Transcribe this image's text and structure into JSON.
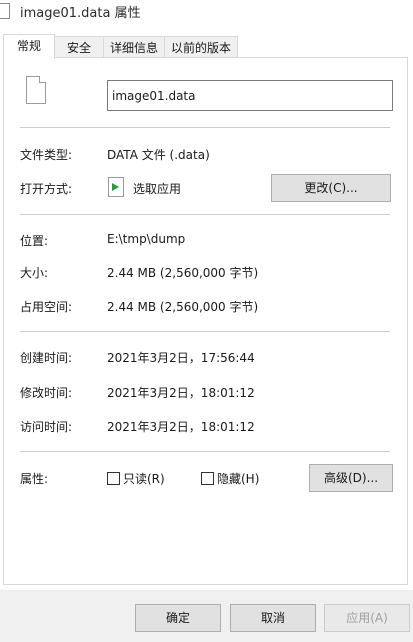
{
  "window": {
    "title": "image01.data 属性"
  },
  "tabs": [
    {
      "label": "常规",
      "active": true
    },
    {
      "label": "安全",
      "active": false
    },
    {
      "label": "详细信息",
      "active": false
    },
    {
      "label": "以前的版本",
      "active": false
    }
  ],
  "general": {
    "file_name": "image01.data",
    "file_type_label": "文件类型:",
    "file_type_value": "DATA 文件 (.data)",
    "open_with_label": "打开方式:",
    "open_with_value": "选取应用",
    "change_button": "更改(C)...",
    "location_label": "位置:",
    "location_value": "E:\\tmp\\dump",
    "size_label": "大小:",
    "size_value": "2.44 MB (2,560,000 字节)",
    "size_on_disk_label": "占用空间:",
    "size_on_disk_value": "2.44 MB (2,560,000 字节)",
    "created_label": "创建时间:",
    "created_value": "2021年3月2日，17:56:44",
    "modified_label": "修改时间:",
    "modified_value": "2021年3月2日，18:01:12",
    "accessed_label": "访问时间:",
    "accessed_value": "2021年3月2日，18:01:12",
    "attributes_label": "属性:",
    "readonly_label": "只读(R)",
    "readonly_checked": false,
    "hidden_label": "隐藏(H)",
    "hidden_checked": false,
    "advanced_button": "高级(D)..."
  },
  "footer": {
    "ok_button": "确定",
    "cancel_button": "取消",
    "apply_button": "应用(A)"
  },
  "icons": {
    "title": "file-icon",
    "file": "file-icon",
    "app": "app-icon",
    "app_color": "#2e9b3a"
  }
}
